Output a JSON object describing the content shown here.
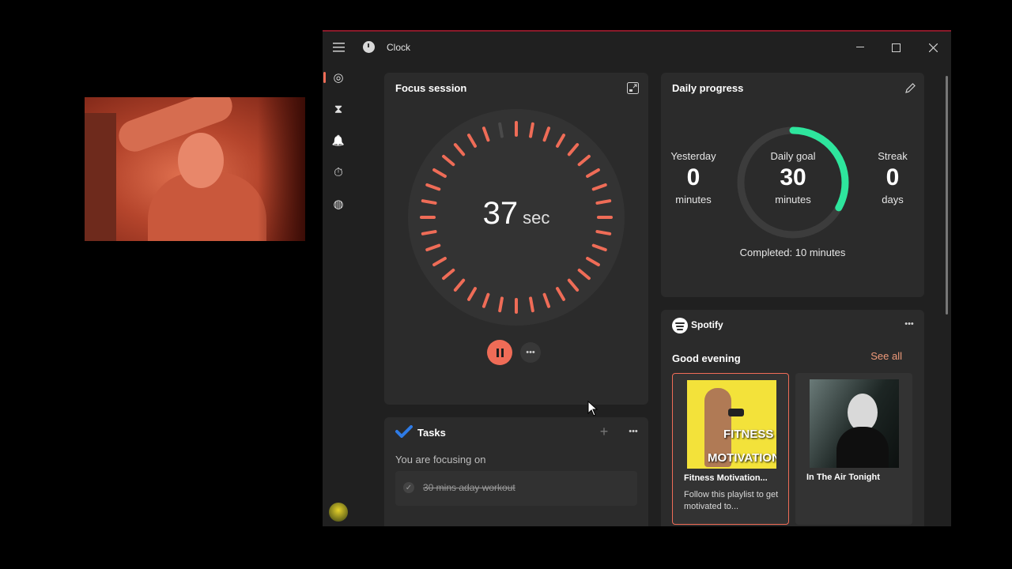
{
  "window": {
    "title": "Clock"
  },
  "sidebar": {
    "items": [
      {
        "name": "focus-sessions",
        "icon": "focus-icon",
        "glyph": "◎",
        "active": true
      },
      {
        "name": "timer",
        "icon": "hourglass-icon",
        "glyph": "⧗",
        "active": false
      },
      {
        "name": "alarm",
        "icon": "bell-icon",
        "glyph": "🔔",
        "active": false
      },
      {
        "name": "stopwatch",
        "icon": "stopwatch-icon",
        "glyph": "⏱",
        "active": false
      },
      {
        "name": "world-clock",
        "icon": "globe-icon",
        "glyph": "◍",
        "active": false
      }
    ]
  },
  "focus": {
    "title": "Focus session",
    "time_value": "37",
    "time_unit": "sec",
    "remaining_fraction": 0.97,
    "accent": "#ef6c57"
  },
  "daily": {
    "title": "Daily progress",
    "yesterday": {
      "label": "Yesterday",
      "value": "0",
      "unit": "minutes"
    },
    "goal": {
      "label": "Daily goal",
      "value": "30",
      "unit": "minutes",
      "progress_fraction": 0.33
    },
    "streak": {
      "label": "Streak",
      "value": "0",
      "unit": "days"
    },
    "completed": "Completed: 10 minutes",
    "ring_color": "#2ee59d"
  },
  "spotify": {
    "brand": "Spotify",
    "greeting": "Good evening",
    "see_all": "See all",
    "playlists": [
      {
        "name": "Fitness Motivation...",
        "desc": "Follow this playlist to get motivated to...",
        "art_text_1": "FITNESS",
        "art_text_2": "MOTIVATION"
      },
      {
        "name": "In The Air Tonight",
        "desc": ""
      }
    ]
  },
  "tasks": {
    "title": "Tasks",
    "heading": "You are focusing on",
    "items": [
      {
        "text": "30 mins aday workout",
        "done": true
      }
    ]
  }
}
